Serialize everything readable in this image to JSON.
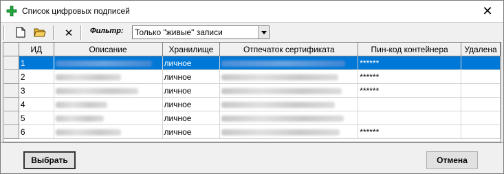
{
  "window": {
    "title": "Список цифровых подписей",
    "close_glyph": "✕"
  },
  "toolbar": {
    "new_icon": "new-document-icon",
    "open_icon": "open-folder-icon",
    "delete_glyph": "✕",
    "filter_label": "Фильтр:",
    "filter_value": "Только \"живые\" записи"
  },
  "grid": {
    "columns": [
      "ИД",
      "Описание",
      "Хранилище",
      "Отпечаток сертификата",
      "Пин-код контейнера",
      "Удалена"
    ],
    "rows": [
      {
        "id": "1",
        "storage": "личное",
        "pin": "******",
        "deleted": "",
        "selected": true
      },
      {
        "id": "2",
        "storage": "личное",
        "pin": "******",
        "deleted": "",
        "selected": false
      },
      {
        "id": "3",
        "storage": "личное",
        "pin": "******",
        "deleted": "",
        "selected": false
      },
      {
        "id": "4",
        "storage": "личное",
        "pin": "",
        "deleted": "",
        "selected": false
      },
      {
        "id": "5",
        "storage": "личное",
        "pin": "",
        "deleted": "",
        "selected": false
      },
      {
        "id": "6",
        "storage": "личное",
        "pin": "******",
        "deleted": "",
        "selected": false
      }
    ]
  },
  "buttons": {
    "select": "Выбрать",
    "cancel": "Отмена"
  },
  "colors": {
    "selection": "#0078d7",
    "app_icon": "#1ea83a"
  }
}
